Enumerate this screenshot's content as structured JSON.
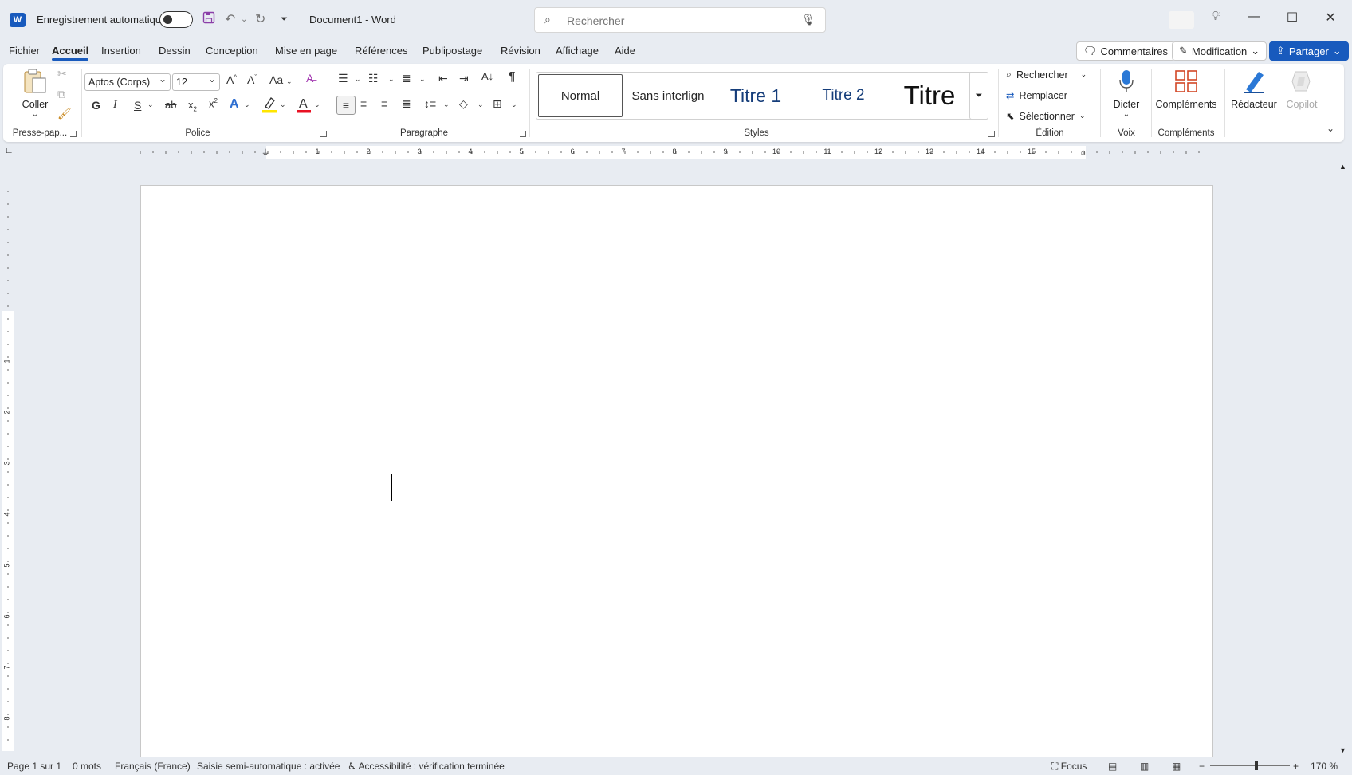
{
  "titlebar": {
    "app_logo": "W",
    "autosave_label": "Enregistrement automatique",
    "document_title": "Document1  -  Word",
    "search_placeholder": "Rechercher"
  },
  "menu": {
    "tabs": [
      "Fichier",
      "Accueil",
      "Insertion",
      "Dessin",
      "Conception",
      "Mise en page",
      "Références",
      "Publipostage",
      "Révision",
      "Affichage",
      "Aide"
    ],
    "active_tab": "Accueil",
    "comments_label": "Commentaires",
    "mode_label": "Modification",
    "share_label": "Partager"
  },
  "ribbon": {
    "clipboard": {
      "paste_label": "Coller",
      "group_label": "Presse-pap..."
    },
    "font": {
      "font_name": "Aptos (Corps)",
      "font_size": "12",
      "bold": "G",
      "italic": "I",
      "underline": "S",
      "strike": "ab",
      "case_label": "Aa",
      "group_label": "Police"
    },
    "paragraph": {
      "group_label": "Paragraphe"
    },
    "styles": {
      "items": [
        "Normal",
        "Sans interlign",
        "Titre 1",
        "Titre 2",
        "Titre"
      ],
      "group_label": "Styles"
    },
    "editing": {
      "find_label": "Rechercher",
      "replace_label": "Remplacer",
      "select_label": "Sélectionner",
      "group_label": "Édition"
    },
    "voice": {
      "dictate_label": "Dicter",
      "group_label": "Voix"
    },
    "addins": {
      "addins_label": "Compléments",
      "group_label": "Compléments"
    },
    "editor_label": "Rédacteur",
    "copilot_label": "Copilot"
  },
  "ruler": {
    "numbers": [
      "1",
      "2",
      "3",
      "4",
      "5",
      "6",
      "7",
      "8",
      "9",
      "10",
      "11",
      "12",
      "13",
      "14",
      "15"
    ],
    "v_numbers": [
      "1",
      "2",
      "3",
      "4",
      "5",
      "6",
      "7",
      "8"
    ]
  },
  "statusbar": {
    "page": "Page 1 sur 1",
    "words": "0 mots",
    "language": "Français (France)",
    "autocomplete": "Saisie semi-automatique : activée",
    "accessibility": "Accessibilité : vérification terminée",
    "focus_label": "Focus",
    "zoom": "170 %"
  },
  "colors": {
    "accent": "#185abd",
    "chrome": "#e8ecf2",
    "font_red": "#e81123",
    "highlight_yellow": "#ffe600"
  }
}
